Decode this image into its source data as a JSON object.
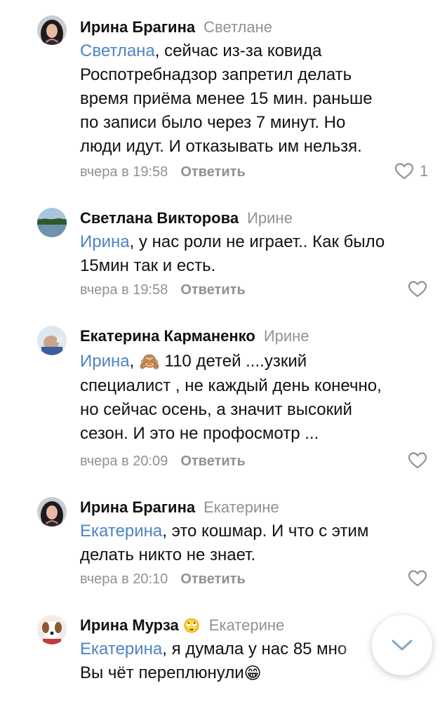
{
  "comments": [
    {
      "author": "Ирина Брагина",
      "reply_to": "Светлане",
      "mention": "Светлана",
      "text_lines": [
        ", сейчас из-за ковида",
        "Роспотребнадзор запретил делать",
        "время приёма менее 15 мин. раньше",
        "по записи было через 7 минут. Но",
        "люди идут. И отказывать им нельзя."
      ],
      "time": "вчера в 19:58",
      "reply_label": "Ответить",
      "likes": "1",
      "avatar_icon": "woman-dark-hair-avatar"
    },
    {
      "author": "Светлана Викторова",
      "reply_to": "Ирине",
      "mention": "Ирина",
      "text_lines": [
        ", у нас роли не играет.. Как было",
        "15мин так и есть."
      ],
      "time": "вчера в 19:58",
      "reply_label": "Ответить",
      "avatar_icon": "lake-landscape-avatar"
    },
    {
      "author": "Екатерина Карманенко",
      "reply_to": "Ирине",
      "mention": "Ирина",
      "emoji": "🙈",
      "text_lines": [
        " 110 детей ....узкий",
        "специалист , не каждый день конечно,",
        "но сейчас осень, а значит высокий",
        "сезон. И это не профосмотр ..."
      ],
      "time": "вчера в 20:09",
      "reply_label": "Ответить",
      "avatar_icon": "baby-photo-avatar"
    },
    {
      "author": "Ирина Брагина",
      "reply_to": "Екатерине",
      "mention": "Екатерина",
      "text_lines": [
        ", это кошмар. И что с этим",
        "делать никто не знает."
      ],
      "time": "вчера в 20:10",
      "reply_label": "Ответить",
      "avatar_icon": "woman-dark-hair-avatar"
    },
    {
      "author": "Ирина Мурза",
      "author_emoji": "🙄",
      "reply_to": "Екатерине",
      "mention": "Екатерина",
      "text_lines": [
        ", я думала у нас 85 мно",
        "Вы чёт переплюнули"
      ],
      "trailing_emoji": "😁",
      "avatar_icon": "dog-photo-avatar"
    }
  ],
  "colors": {
    "mention": "#4d84c4",
    "meta": "#8e9296",
    "text": "#111111"
  },
  "scroll_button_icon": "chevron-down-icon"
}
